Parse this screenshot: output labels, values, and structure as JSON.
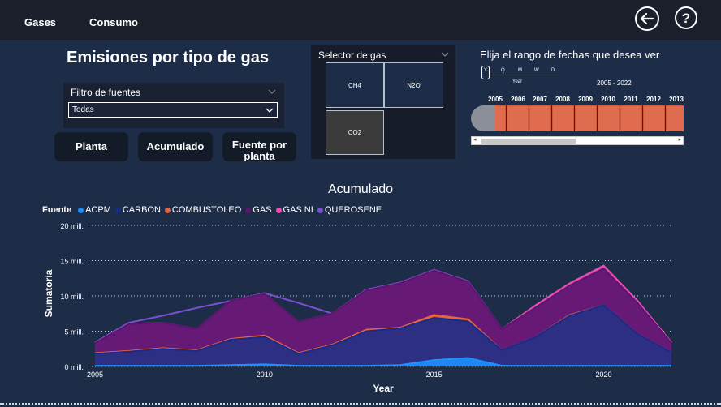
{
  "nav": {
    "gases": "Gases",
    "consumo": "Consumo"
  },
  "title": "Emisiones por tipo de gas",
  "filter": {
    "title": "Filtro de fuentes",
    "value": "Todas"
  },
  "buttons": {
    "planta": "Planta",
    "acumulado": "Acumulado",
    "fuente_line1": "Fuente por",
    "fuente_line2": "planta"
  },
  "gas_selector": {
    "title": "Selector de gas",
    "options": [
      "CH4",
      "N2O",
      "CO2"
    ],
    "selected": "CO2"
  },
  "date_range": {
    "title": "Elija el rango de fechas que desea ver",
    "granularity": [
      "Y",
      "Q",
      "M",
      "W",
      "D"
    ],
    "granularity_selected": "Y",
    "granularity_label": "Year",
    "range": "2005 - 2022",
    "years": [
      "2005",
      "2006",
      "2007",
      "2008",
      "2009",
      "2010",
      "2011",
      "2012",
      "2013"
    ]
  },
  "colors": {
    "ACPM": "#1e90ff",
    "CARBON": "#1a2a8a",
    "COMBUSTOLEO": "#e8663d",
    "GAS": "#5b1570",
    "GAS NI": "#e84fb0",
    "QUEROSENE": "#7b4fd6",
    "timeline": "#e06c50"
  },
  "chart_data": {
    "type": "area",
    "title": "Acumulado",
    "legend_title": "Fuente",
    "xlabel": "Year",
    "ylabel": "Sumatoria",
    "x": [
      2005,
      2006,
      2007,
      2008,
      2009,
      2010,
      2011,
      2012,
      2013,
      2014,
      2015,
      2016,
      2017,
      2018,
      2019,
      2020,
      2021,
      2022
    ],
    "x_ticks": [
      "2005",
      "2010",
      "2015",
      "2020"
    ],
    "y_ticks": [
      "0 mill.",
      "5 mill.",
      "10 mill.",
      "15 mill.",
      "20 mill."
    ],
    "ylim": [
      0,
      20
    ],
    "stacked": true,
    "series": [
      {
        "name": "ACPM",
        "cumulative": [
          0.1,
          0.1,
          0.1,
          0.1,
          0.2,
          0.3,
          0.1,
          0.1,
          0.1,
          0.2,
          0.9,
          1.2,
          0.1,
          0.1,
          0.1,
          0.1,
          0.1,
          0.1
        ]
      },
      {
        "name": "CARBON",
        "cumulative": [
          1.8,
          2.1,
          2.5,
          2.2,
          3.8,
          4.2,
          1.8,
          3.0,
          5.0,
          5.4,
          6.9,
          6.4,
          2.3,
          4.2,
          7.2,
          8.7,
          4.6,
          2.0
        ]
      },
      {
        "name": "COMBUSTOLEO",
        "cumulative": [
          1.9,
          2.2,
          2.6,
          2.3,
          3.9,
          4.4,
          1.9,
          3.1,
          5.2,
          5.5,
          7.3,
          6.7,
          2.3,
          4.2,
          7.3,
          8.7,
          4.6,
          2.0
        ]
      },
      {
        "name": "GAS",
        "cumulative": [
          3.3,
          6.0,
          6.2,
          5.3,
          9.3,
          10.3,
          6.3,
          7.5,
          10.8,
          11.8,
          13.6,
          12.0,
          5.3,
          8.4,
          11.5,
          13.9,
          9.0,
          3.3
        ]
      },
      {
        "name": "GAS NI",
        "cumulative": [
          3.3,
          6.0,
          6.2,
          5.3,
          9.3,
          10.3,
          6.3,
          7.5,
          10.8,
          11.8,
          13.6,
          12.0,
          5.3,
          8.7,
          11.8,
          14.3,
          9.3,
          3.4
        ]
      },
      {
        "name": "QUEROSENE",
        "cumulative": [
          3.4,
          6.2,
          7.2,
          8.3,
          9.3,
          10.4,
          9.0,
          7.5,
          10.9,
          11.9,
          13.7,
          12.1,
          5.3,
          8.4,
          11.5,
          14.0,
          9.1,
          3.4
        ]
      }
    ]
  }
}
